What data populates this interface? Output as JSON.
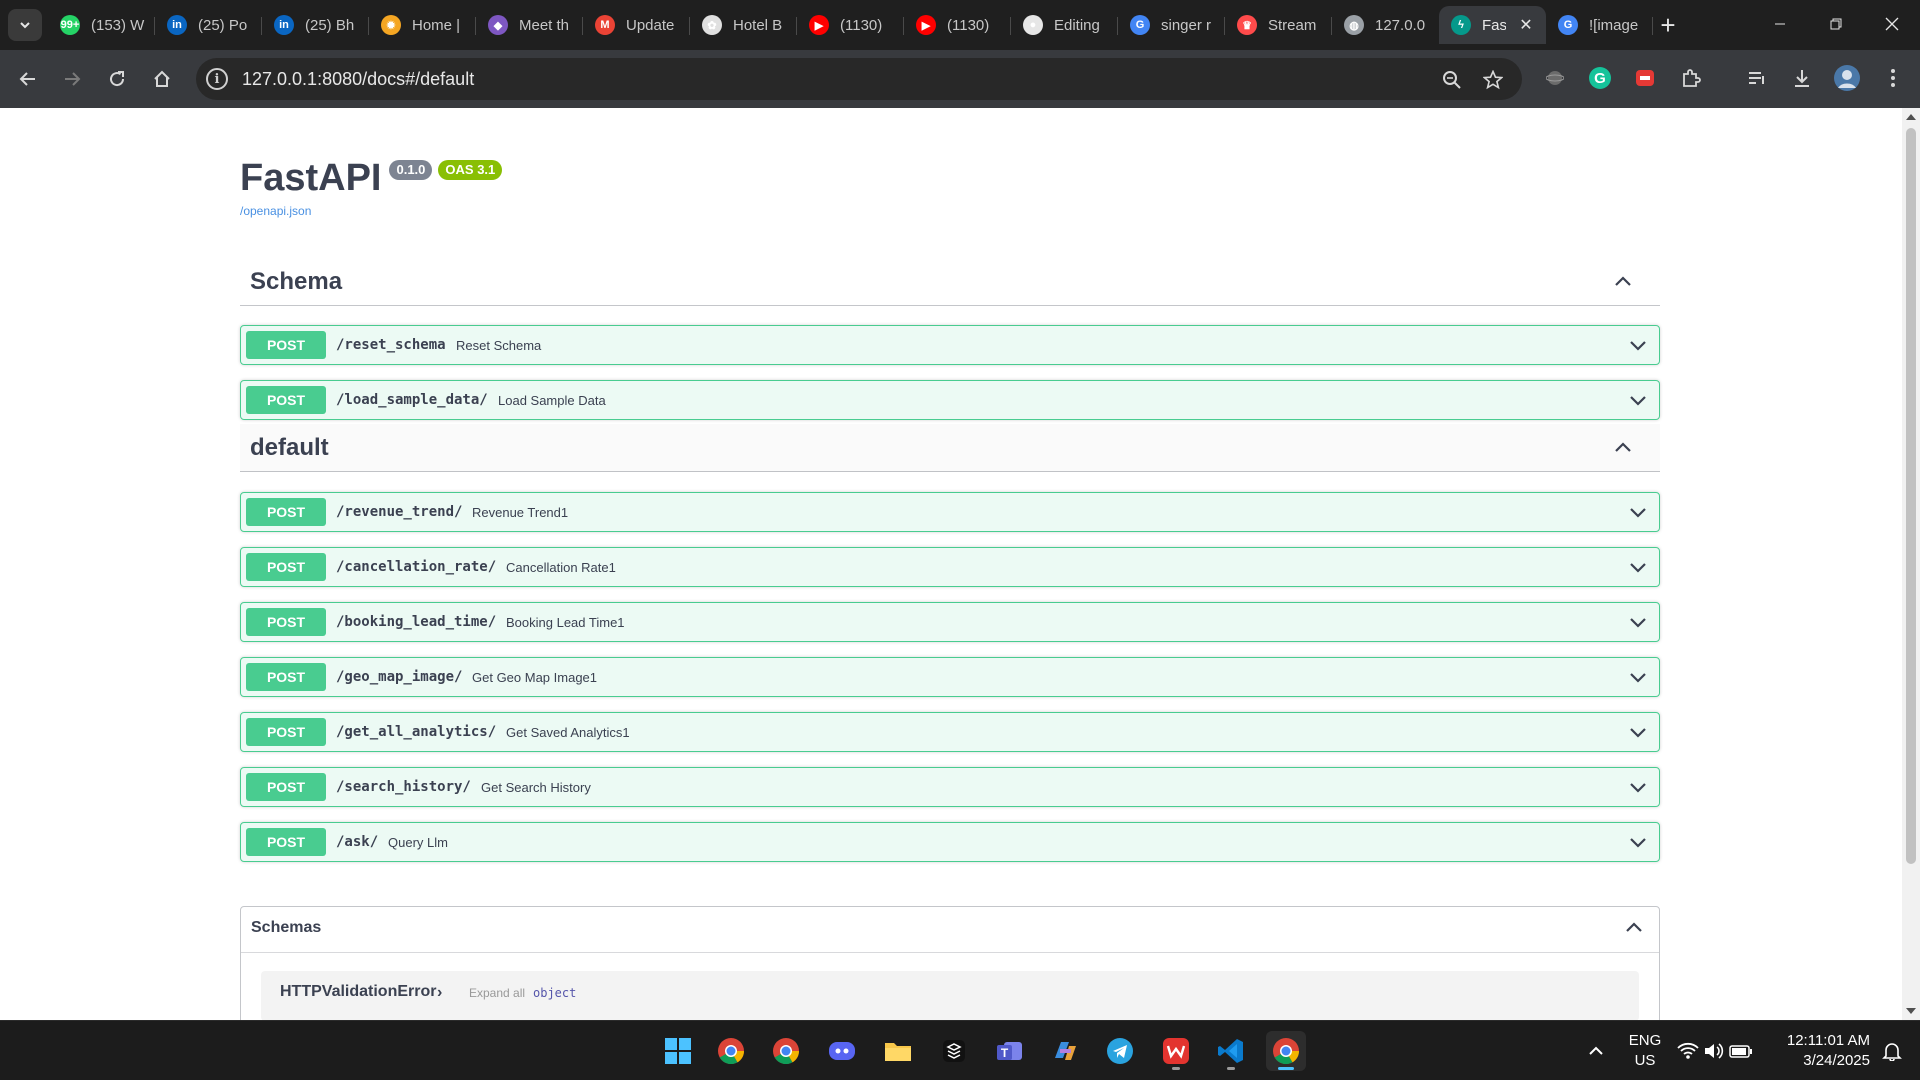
{
  "browser": {
    "tabs": [
      {
        "title": "(153) W",
        "favicon": "whatsapp-icon",
        "color": "#25d366",
        "glyph": "99+"
      },
      {
        "title": "(25) Po",
        "favicon": "linkedin-icon",
        "color": "#0a66c2",
        "glyph": "in"
      },
      {
        "title": "(25) Bh",
        "favicon": "linkedin-icon",
        "color": "#0a66c2",
        "glyph": "in"
      },
      {
        "title": "Home |",
        "favicon": "sun-logo-icon",
        "color": "#f5a623",
        "glyph": "✹"
      },
      {
        "title": "Meet th",
        "favicon": "diamond-logo-icon",
        "color": "#7e57c2",
        "glyph": "◆"
      },
      {
        "title": "Update",
        "favicon": "gmail-icon",
        "color": "#ea4335",
        "glyph": "M"
      },
      {
        "title": "Hotel B",
        "favicon": "openai-icon",
        "color": "#e0e0e0",
        "glyph": "✿"
      },
      {
        "title": "(1130)",
        "favicon": "youtube-icon",
        "color": "#ff0000",
        "glyph": "▶"
      },
      {
        "title": "(1130)",
        "favicon": "youtube-icon",
        "color": "#ff0000",
        "glyph": "▶"
      },
      {
        "title": "Editing",
        "favicon": "github-icon",
        "color": "#e6e6e6",
        "glyph": "●"
      },
      {
        "title": "singer r",
        "favicon": "google-icon",
        "color": "#4285f4",
        "glyph": "G"
      },
      {
        "title": "Stream",
        "favicon": "streamlit-icon",
        "color": "#ff4b4b",
        "glyph": "♛"
      },
      {
        "title": "127.0.0",
        "favicon": "globe-icon",
        "color": "#9aa0a6",
        "glyph": "◍"
      },
      {
        "title": "Fas",
        "favicon": "fastapi-icon",
        "color": "#05998b",
        "glyph": "ϟ",
        "active": true
      },
      {
        "title": "![image",
        "favicon": "google-icon",
        "color": "#4285f4",
        "glyph": "G"
      }
    ],
    "url": "127.0.0.1:8080/docs#/default"
  },
  "api": {
    "title": "FastAPI",
    "version": "0.1.0",
    "oas": "OAS 3.1",
    "openapi_link": "/openapi.json"
  },
  "tags": [
    {
      "name": "Schema",
      "endpoints": [
        {
          "method": "POST",
          "path": "/reset_schema",
          "summary": "Reset Schema"
        },
        {
          "method": "POST",
          "path": "/load_sample_data/",
          "summary": "Load Sample Data"
        }
      ]
    },
    {
      "name": "default",
      "endpoints": [
        {
          "method": "POST",
          "path": "/revenue_trend/",
          "summary": "Revenue Trend1"
        },
        {
          "method": "POST",
          "path": "/cancellation_rate/",
          "summary": "Cancellation Rate1"
        },
        {
          "method": "POST",
          "path": "/booking_lead_time/",
          "summary": "Booking Lead Time1"
        },
        {
          "method": "POST",
          "path": "/geo_map_image/",
          "summary": "Get Geo Map Image1"
        },
        {
          "method": "POST",
          "path": "/get_all_analytics/",
          "summary": "Get Saved Analytics1"
        },
        {
          "method": "POST",
          "path": "/search_history/",
          "summary": "Get Search History"
        },
        {
          "method": "POST",
          "path": "/ask/",
          "summary": "Query Llm"
        }
      ]
    }
  ],
  "schemas": {
    "title": "Schemas",
    "items": [
      {
        "name": "HTTPValidationError",
        "expand_label": "Expand all",
        "type": "object"
      }
    ]
  },
  "taskbar": {
    "apps": [
      "windows-start-icon",
      "chrome-icon",
      "chrome-icon",
      "discord-icon",
      "file-explorer-icon",
      "app-icon",
      "teams-icon",
      "copilot-icon",
      "telegram-icon",
      "wps-office-icon",
      "vscode-icon",
      "chrome-icon"
    ],
    "lang": "ENG",
    "region": "US",
    "time": "12:11:01 AM",
    "date": "3/24/2025"
  },
  "colors": {
    "post": "#49cc90",
    "post_bg": "rgba(73,204,144,.1)",
    "text": "#3b4151",
    "version_badge": "#7d8492",
    "oas_badge": "#89bf04",
    "link": "#4990e2"
  }
}
